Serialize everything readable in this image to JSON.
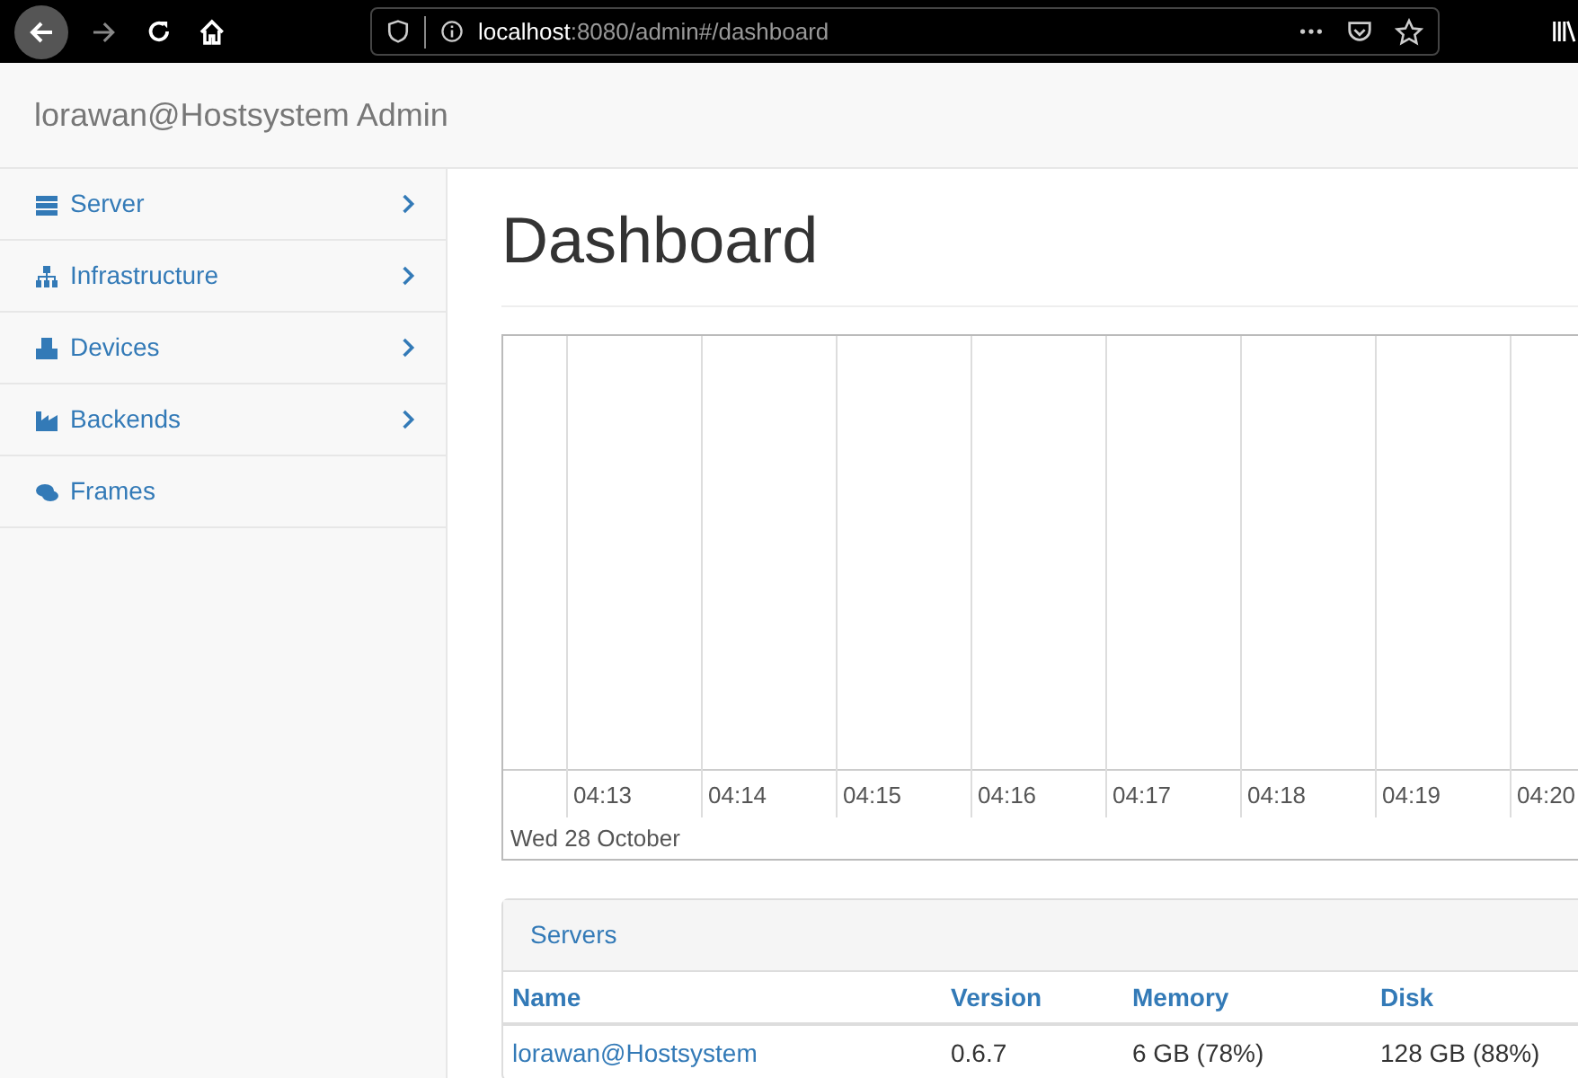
{
  "browser": {
    "url_host": "localhost",
    "url_path": ":8080/admin#/dashboard"
  },
  "navbar": {
    "brand": "lorawan@Hostsystem Admin"
  },
  "sidebar": {
    "items": [
      {
        "label": "Server",
        "expandable": true
      },
      {
        "label": "Infrastructure",
        "expandable": true
      },
      {
        "label": "Devices",
        "expandable": true
      },
      {
        "label": "Backends",
        "expandable": true
      },
      {
        "label": "Frames",
        "expandable": false
      }
    ]
  },
  "page": {
    "title": "Dashboard"
  },
  "timeline": {
    "ticks": [
      "04:13",
      "04:14",
      "04:15",
      "04:16",
      "04:17",
      "04:18",
      "04:19",
      "04:20"
    ],
    "date": "Wed 28 October"
  },
  "servers": {
    "title": "Servers",
    "columns": [
      "Name",
      "Version",
      "Memory",
      "Disk"
    ],
    "rows": [
      [
        "lorawan@Hostsystem",
        "0.6.7",
        "6 GB (78%)",
        "128 GB (88%)"
      ]
    ]
  }
}
